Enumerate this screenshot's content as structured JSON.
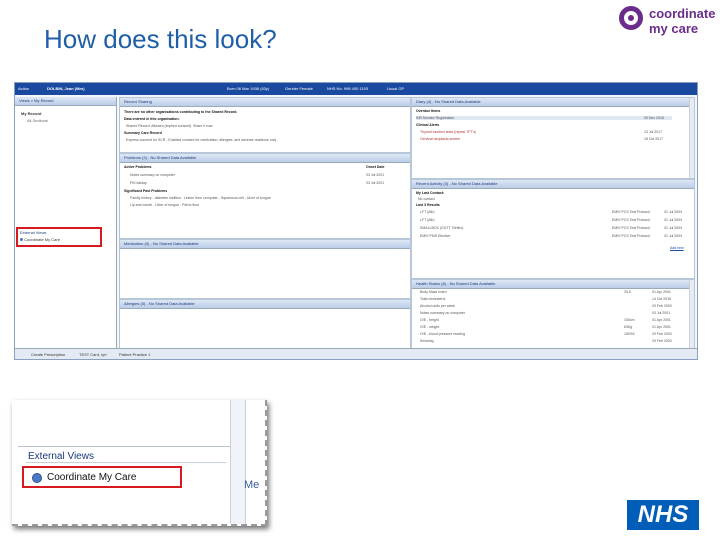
{
  "slide": {
    "title": "How does this look?"
  },
  "logo": {
    "line1": "coordinate",
    "line2": "my care"
  },
  "app": {
    "topbar": {
      "action": "Action",
      "patient": "DOLBIN, Jean (Mrs)",
      "born": "Born 06 Mar 1936 (83y)",
      "gender": "Gender Female",
      "nhs_no": "NHS No. 998 400 1193",
      "usual_gp": "Usual GP"
    },
    "left_pane": {
      "header": "Views > My Record",
      "my_record": "My Record",
      "all_sections": "All Sections",
      "external_views": "External Views",
      "cmc_item": "Coordinate My Care"
    },
    "record_sharing": {
      "header": "Record Sharing",
      "line1": "There are no other organisations contributing to the Shared Record.",
      "line2": "Data entered in this organisation:",
      "line3": "Shared Record: Allowed (implied consent). Share it now",
      "summary_care": "Summary Care Record",
      "summary_line": "Express consent for SCR - Enabled consent for medication, allergies, and adverse reactions only"
    },
    "problems": {
      "header": "Problems (3) - No Shared Data Available",
      "col_active": "Active Problems",
      "col_onset": "Onset Date",
      "rows": [
        {
          "name": "Notes summary on computer",
          "date": "03 Jul 2001"
        },
        {
          "name": "Pill holiday",
          "date": "03 Jul 2001"
        }
      ],
      "significant": "Significant Past Problems",
      "sig_rows": [
        "Family history - diabetes mellitus - Lesion from computer - Squamous cell - Ulcer of tongue",
        "Lip and mouth - Ulcer of tongue - Pelvic floor"
      ]
    },
    "medication": {
      "header": "Medication (0) - No Shared Data Available"
    },
    "allergies": {
      "header": "Allergies (0) - No Shared Data Available"
    },
    "diary": {
      "header": "Diary (4) - No Shared Data Available",
      "rows": [
        {
          "name": "Overdue Items",
          "date": ""
        },
        {
          "name": "INR Monitor Registration",
          "date": "30 Dec 2016"
        },
        {
          "name": "Clinical Alerts",
          "date": ""
        },
        {
          "name": "Thyroid function tests (repeat TFT's)",
          "date": "13 Jul 2017"
        },
        {
          "name": "Cervical neoplasia screen",
          "date": "18 Oct 2017"
        }
      ]
    },
    "recent_activity": {
      "header": "Recent Activity (3) - No Shared Data Available",
      "last_contact": "My Last Contact:",
      "no_contact": "No contact",
      "last_results": "Last 3 Results",
      "rows": [
        {
          "name": "LFT (Alb)",
          "source": "EMIS PCS Test Protocol",
          "date": "31 Jul 2003"
        },
        {
          "name": "LFT (Alb)",
          "source": "EMIS PCS Test Protocol",
          "date": "31 Jul 2003"
        },
        {
          "name": "SMALLBOX (GGTT, Reflex)",
          "source": "EMIS PCS Test Protocol",
          "date": "31 Jul 2003"
        },
        {
          "name": "EMIS PMS Elective",
          "source": "EMIS PCS Test Protocol",
          "date": "31 Jul 2003"
        }
      ],
      "add_link": "Add new"
    },
    "health_status": {
      "header": "Health Status (8) - No Shared Data Available",
      "rows": [
        {
          "name": "Body Mass Index",
          "value": "25.5",
          "date": "01 Apr 2001"
        },
        {
          "name": "Total cholesterol",
          "value": "",
          "date": "14 Oct 2016"
        },
        {
          "name": "Alcohol units per week",
          "value": "",
          "date": "29 Feb 2000"
        },
        {
          "name": "Notes summary on computer",
          "value": "",
          "date": "03 Jul 2001"
        },
        {
          "name": "O/E - height",
          "value": "150cm",
          "date": "01 Apr 2001"
        },
        {
          "name": "O/E - weight",
          "value": "63Kg",
          "date": "01 Apr 2001"
        },
        {
          "name": "O/E - blood pressure reading",
          "value": "150/92",
          "date": "29 Feb 2000"
        },
        {
          "name": "Smoking",
          "value": "",
          "date": "29 Feb 2000"
        }
      ]
    },
    "statusbar": {
      "item1": "Create Prescription",
      "item2": "TEST Card, Iyri",
      "item3": "Patient Practice 1"
    }
  },
  "zoom": {
    "external_views": "External Views",
    "cmc_item": "Coordinate My Care",
    "partial": "Me"
  },
  "nhs": {
    "label": "NHS"
  },
  "colors": {
    "title": "#1f5fa8",
    "brand_purple": "#6b2d8b",
    "highlight_red": "#d71920",
    "nhs_blue": "#005eb8",
    "emis_blue": "#1a4aa0"
  }
}
